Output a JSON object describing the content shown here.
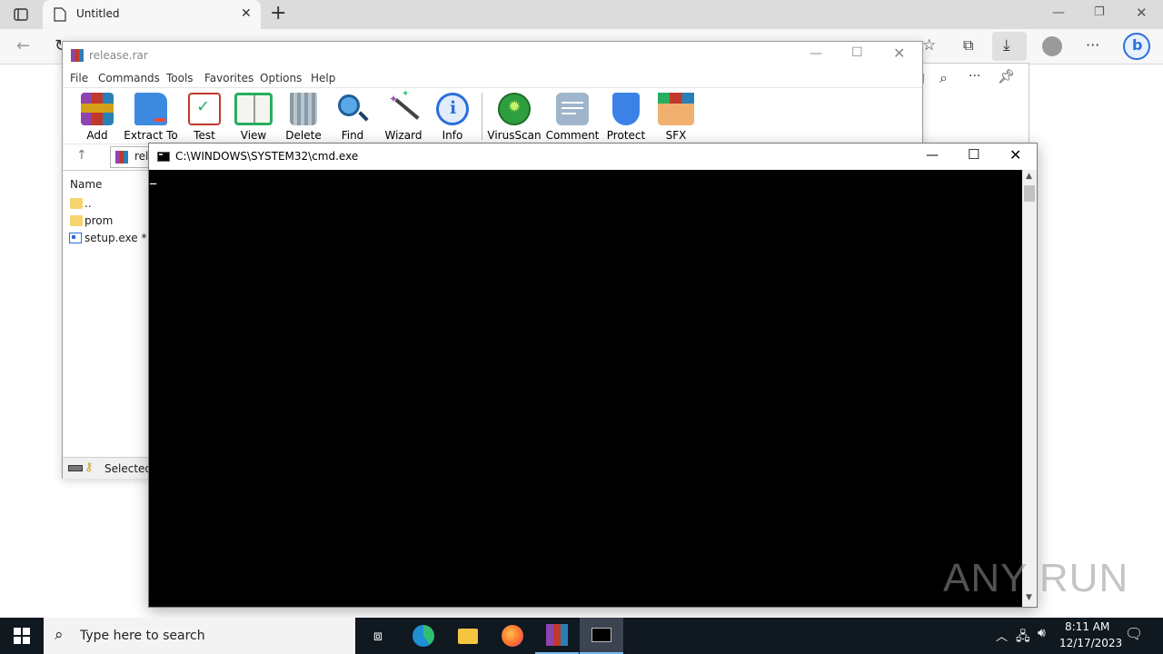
{
  "browser": {
    "tab_title": "Untitled",
    "new_tab": "+",
    "window_controls": [
      "minimize",
      "restore",
      "close"
    ]
  },
  "winrar": {
    "title": "release.rar",
    "menu": [
      "File",
      "Commands",
      "Tools",
      "Favorites",
      "Options",
      "Help"
    ],
    "tools": [
      {
        "label": "Add",
        "icon": "add-archive-icon",
        "color": "#c0392b"
      },
      {
        "label": "Extract To",
        "icon": "extract-folder-icon",
        "color": "#2e86de"
      },
      {
        "label": "Test",
        "icon": "test-checklist-icon",
        "color": "#c0392b"
      },
      {
        "label": "View",
        "icon": "view-book-icon",
        "color": "#27ae60"
      },
      {
        "label": "Delete",
        "icon": "trash-icon",
        "color": "#7f8c8d"
      },
      {
        "label": "Find",
        "icon": "magnifier-icon",
        "color": "#2980b9"
      },
      {
        "label": "Wizard",
        "icon": "magic-wand-icon",
        "color": "#8e44ad"
      },
      {
        "label": "Info",
        "icon": "info-icon",
        "color": "#2a6fdb"
      },
      {
        "label": "VirusScan",
        "icon": "bug-scan-icon",
        "color": "#2e9e3e"
      },
      {
        "label": "Comment",
        "icon": "comment-icon",
        "color": "#6c8fb0"
      },
      {
        "label": "Protect",
        "icon": "shield-icon",
        "color": "#2a6fdb"
      },
      {
        "label": "SFX",
        "icon": "sfx-box-icon",
        "color": "#e67e22"
      }
    ],
    "path_partial": "rele",
    "column_name": "Name",
    "files": [
      {
        "name": "..",
        "type": "folder"
      },
      {
        "name": "prom",
        "type": "folder"
      },
      {
        "name": "setup.exe *",
        "type": "exe"
      }
    ],
    "status": "Selected"
  },
  "cmd": {
    "title": "C:\\WINDOWS\\SYSTEM32\\cmd.exe",
    "cursor": "_"
  },
  "watermark": "ANY RUN",
  "taskbar": {
    "search_placeholder": "Type here to search",
    "time": "8:11 AM",
    "date": "12/17/2023"
  }
}
